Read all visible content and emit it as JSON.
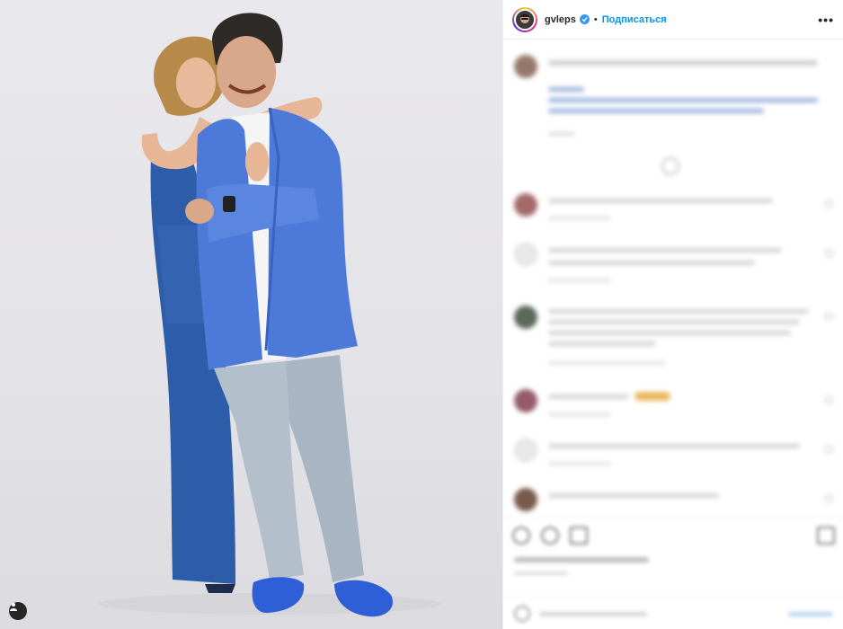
{
  "post": {
    "username": "gvleps",
    "follow_label": "Подписаться",
    "separator": "•",
    "more_glyph": "•••",
    "verified": true
  },
  "photo": {
    "alt": "",
    "tag_icon": "user-tag-icon"
  },
  "colors": {
    "link_blue": "#0095f6",
    "verified_blue": "#3897f0",
    "jacket_blue": "#4d79d8",
    "dress_blue": "#2d5da8"
  }
}
